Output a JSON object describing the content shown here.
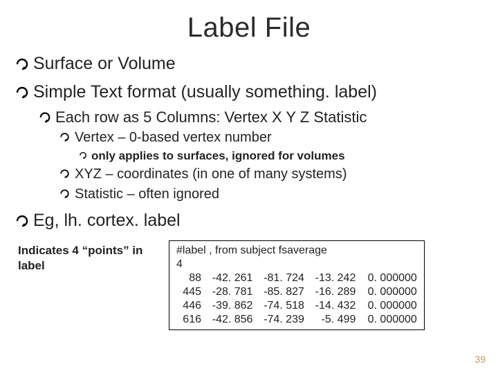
{
  "title": "Label File",
  "bullets": {
    "b1": "Surface or Volume",
    "b2": "Simple Text format (usually something. label)",
    "b2_1": "Each row as 5 Columns: Vertex  X Y Z Statistic",
    "b2_1_1": "Vertex – 0-based vertex number",
    "b2_1_1_1": "only applies to surfaces, ignored for volumes",
    "b2_1_2": "XYZ – coordinates (in one of many systems)",
    "b2_1_3": "Statistic – often ignored",
    "b3": "Eg, lh. cortex. label"
  },
  "caption": "Indicates 4 “points” in label",
  "file": {
    "header": "#label , from subject fsaverage",
    "count": "4",
    "rows": [
      {
        "vtx": "  88",
        "x": "-42. 261",
        "y": "-81. 724",
        "z": "-13. 242",
        "stat": "0. 000000"
      },
      {
        "vtx": "445",
        "x": "-28. 781",
        "y": "-85. 827",
        "z": "-16. 289",
        "stat": "0. 000000"
      },
      {
        "vtx": "446",
        "x": "-39. 862",
        "y": "-74. 518",
        "z": "-14. 432",
        "stat": "0. 000000"
      },
      {
        "vtx": "616",
        "x": "-42. 856",
        "y": "-74. 239",
        "z": " -5. 499",
        "stat": "0. 000000"
      }
    ]
  },
  "page": "39"
}
